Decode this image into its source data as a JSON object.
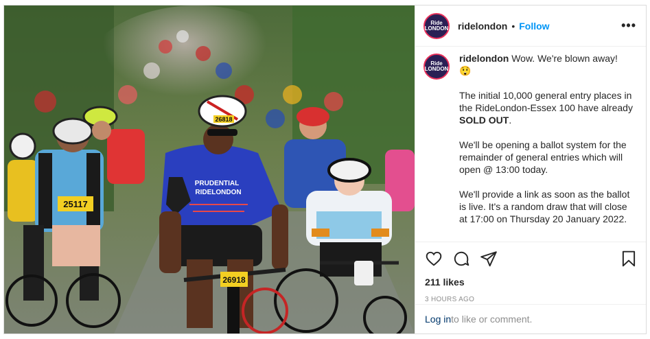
{
  "post": {
    "username": "ridelondon",
    "follow_label": "Follow",
    "separator": "•",
    "more_label": "•••",
    "avatar_text_line1": "Ride",
    "avatar_text_line2": "LONDON",
    "caption_intro": "Wow. We're blown away!",
    "caption_emoji": "😲",
    "caption_p2_pre": "The initial 10,000 general entry places in the RideLondon-Essex 100 have already ",
    "caption_p2_bold": "SOLD OUT",
    "caption_p2_post": ".",
    "caption_p3": "We'll be opening a ballot system for the remainder of general entries which will open @ 13:00 today.",
    "caption_p4": "We'll provide a link as soon as the ballot is live. It's a random draw that will close at 17:00 on Thursday 20 January 2022.",
    "likes": "211 likes",
    "time": "3 HOURS AGO",
    "login_link": "Log in",
    "login_rest": " to like or comment.",
    "photo": {
      "bib_main": "26918",
      "bib_left": "25117",
      "bib_bike": "26918",
      "jersey_text1": "PRUDENTIAL",
      "jersey_text2": "RIDELONDON",
      "helmet_text": "26818"
    }
  },
  "icons": {
    "like": "heart-icon",
    "comment": "comment-icon",
    "share": "share-icon",
    "save": "bookmark-icon",
    "more": "more-options-icon"
  },
  "colors": {
    "follow": "#0095f6",
    "brand_avatar": "#2a1f54",
    "avatar_ring": "#e8305a",
    "jersey": "#2a3fbf"
  }
}
